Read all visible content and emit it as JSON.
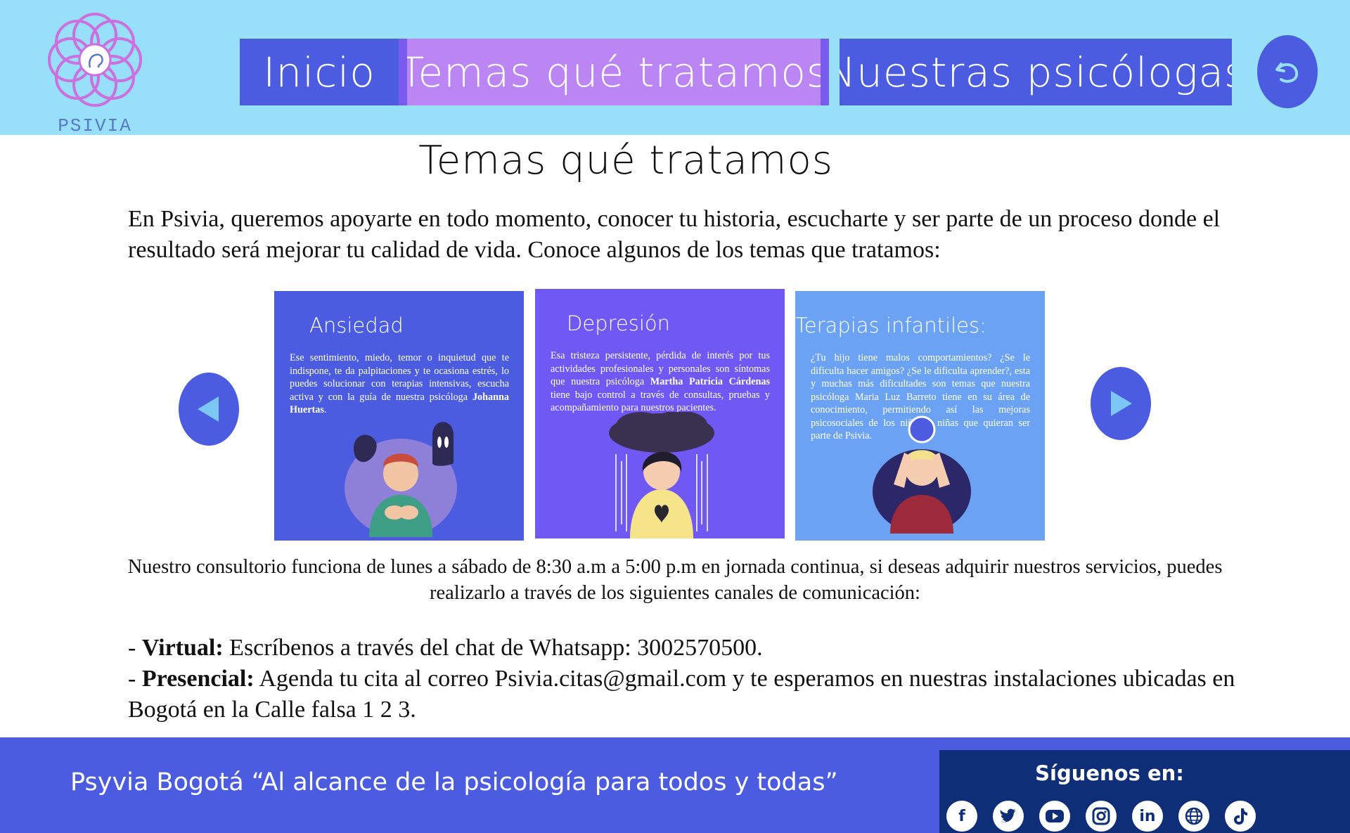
{
  "header": {
    "logo_text": "PSIVIA",
    "nav": {
      "inicio": "Inicio",
      "temas": "Temas qué tratamos",
      "psicologas": "Nuestras psicólogas"
    }
  },
  "main": {
    "title": "Temas qué tratamos",
    "intro": "En Psivia, queremos apoyarte en todo momento, conocer tu historia, escucharte y ser parte de un proceso donde el resultado será mejorar tu calidad de vida. Conoce algunos de los temas que tratamos:",
    "cards": [
      {
        "title": "Ansiedad",
        "text": "Ese sentimiento, miedo, temor o inquietud que te indispone, te da palpitaciones y te ocasiona estrés, lo puedes solucionar con terapias intensivas, escucha activa y con la guía de nuestra psicóloga",
        "bold": "Johanna Huertas",
        "tail": "."
      },
      {
        "title": "Depresión",
        "text_before": "Esa tristeza persistente, pérdida de interés por tus actividades profesionales y personales son síntomas que nuestra psicóloga",
        "bold": "Martha Patricia Cárdenas",
        "text_after": "tiene bajo control a través de consultas, pruebas y acompañamiento para nuestros pacientes."
      },
      {
        "title": "Terapias infantiles:",
        "text": "¿Tu hijo tiene malos comportamientos? ¿Se le dificulta hacer amigos? ¿Se le dificulta aprender?, esta y muchas más dificultades son temas que nuestra psicóloga Maria Luz Barreto tiene en su área de conocimiento, permitiendo así las mejoras psicosociales de los niños y niñas que quieran ser parte de Psivia."
      }
    ],
    "schedule": "Nuestro consultorio funciona de lunes a sábado de 8:30 a.m a 5:00 p.m en jornada continua, si deseas adquirir nuestros servicios, puedes realizarlo a través de los siguientes canales de comunicación:",
    "contact": {
      "virtual_prefix": "-  ",
      "virtual_label": "Virtual:",
      "virtual_text": "  Escríbenos a través del chat de Whatsapp: 3002570500.",
      "presencial_prefix": "- ",
      "presencial_label": "Presencial:",
      "presencial_text": "  Agenda tu cita al correo Psivia.citas@gmail.com y te esperamos en nuestras instalaciones ubicadas en Bogotá en la Calle falsa 1 2 3."
    }
  },
  "footer": {
    "slogan": "Psyvia Bogotá “Al alcance de la psicología para todos y todas”",
    "social_title": "Síguenos en:",
    "social_icons": [
      "facebook-icon",
      "twitter-icon",
      "youtube-icon",
      "instagram-icon",
      "linkedin-icon",
      "globe-icon",
      "tiktok-icon"
    ]
  },
  "colors": {
    "header_bg": "#98dff9",
    "accent_blue": "#4b5ce0",
    "accent_lilac": "#bb86f3",
    "card_violet": "#7058f5",
    "card_light_blue": "#6ca2f3",
    "social_bg": "#0e2f78"
  }
}
